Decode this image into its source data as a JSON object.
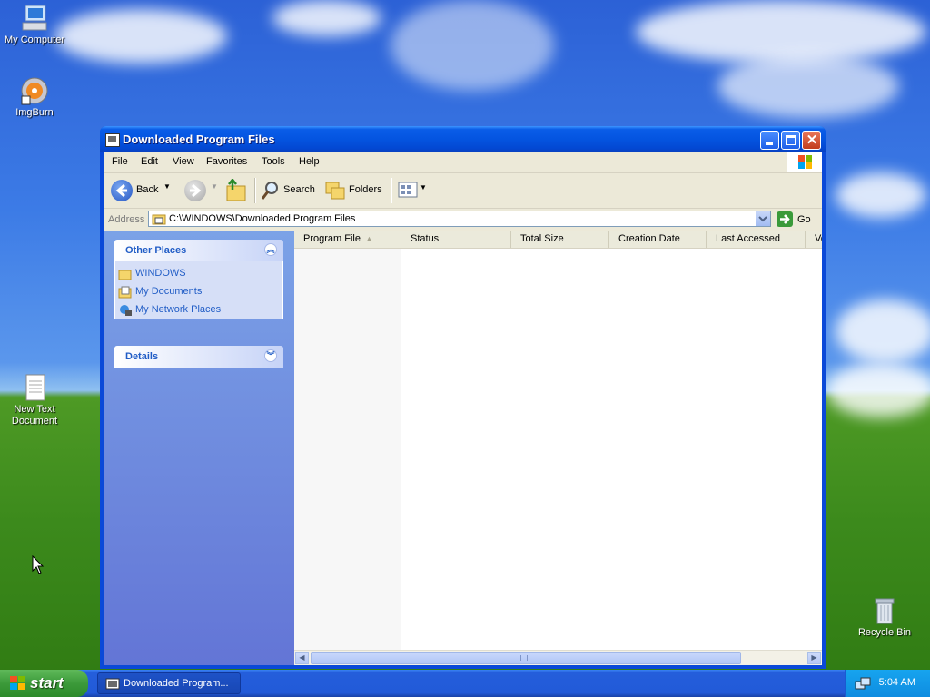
{
  "desktop": {
    "icons": [
      {
        "label_line1": "My Computer",
        "label_line2": ""
      },
      {
        "label_line1": "ImgBurn",
        "label_line2": ""
      },
      {
        "label_line1": "New Text",
        "label_line2": "Document"
      },
      {
        "label_line1": "Recycle Bin",
        "label_line2": ""
      }
    ]
  },
  "window": {
    "title": "Downloaded Program Files",
    "menu": [
      "File",
      "Edit",
      "View",
      "Favorites",
      "Tools",
      "Help"
    ],
    "toolbar": {
      "back_label": "Back",
      "search_label": "Search",
      "folders_label": "Folders"
    },
    "address": {
      "label": "Address",
      "value": "C:\\WINDOWS\\Downloaded Program Files",
      "go_label": "Go"
    },
    "taskpane": {
      "other_places": {
        "title": "Other Places",
        "links": [
          "WINDOWS",
          "My Documents",
          "My Network Places"
        ]
      },
      "details": {
        "title": "Details"
      }
    },
    "columns": [
      "Program File",
      "Status",
      "Total Size",
      "Creation Date",
      "Last Accessed",
      "Ve"
    ]
  },
  "taskbar": {
    "start_label": "start",
    "task_button_label": "Downloaded Program...",
    "clock": "5:04 AM"
  }
}
